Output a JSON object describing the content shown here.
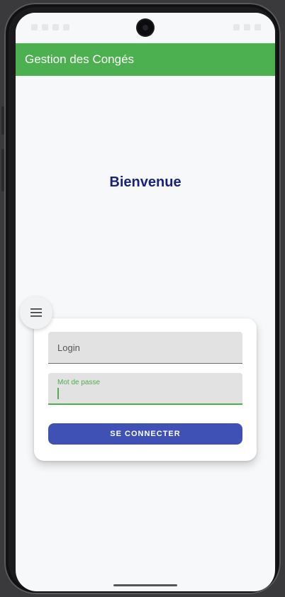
{
  "app_bar": {
    "title": "Gestion des Congés",
    "color": "#4caf50"
  },
  "main": {
    "welcome_text": "Bienvenue",
    "welcome_color": "#1a237e"
  },
  "menu_button": {
    "icon": "hamburger-menu-icon"
  },
  "login_form": {
    "login_placeholder": "Login",
    "password_label": "Mot de passe",
    "password_value": "",
    "submit_label": "SE CONNECTER",
    "submit_color": "#3f51b5"
  }
}
